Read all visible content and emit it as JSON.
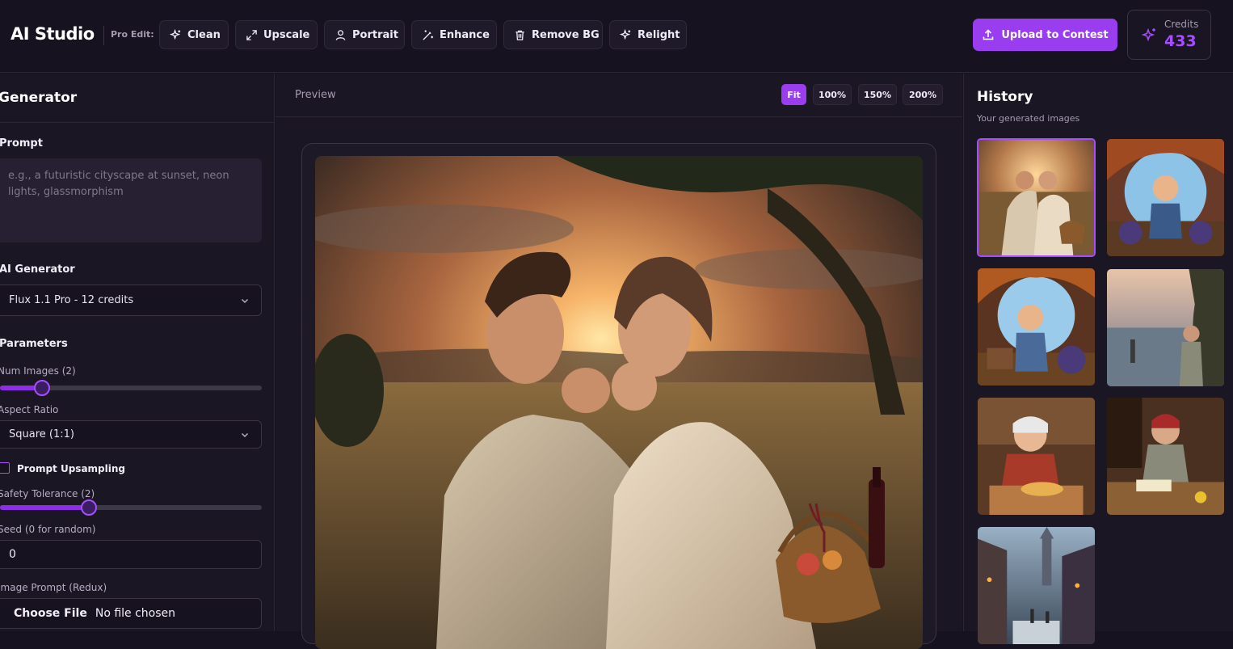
{
  "app": {
    "title": "AI Studio"
  },
  "toolbar": {
    "pro_edit_label": "Pro Edit:",
    "buttons": [
      {
        "label": "Clean",
        "icon": "sparkles-icon"
      },
      {
        "label": "Upscale",
        "icon": "expand-icon"
      },
      {
        "label": "Portrait",
        "icon": "user-icon"
      },
      {
        "label": "Enhance",
        "icon": "magic-wand-icon"
      },
      {
        "label": "Remove BG",
        "icon": "trash-icon"
      },
      {
        "label": "Relight",
        "icon": "sparkles-icon"
      }
    ],
    "upload_label": "Upload to Contest",
    "credits_label": "Credits",
    "credits_value": "433"
  },
  "generator": {
    "title": "Generator",
    "prompt_label": "Prompt",
    "prompt_placeholder": "e.g., a futuristic cityscape at sunset, neon lights, glassmorphism",
    "model_label": "AI Generator",
    "model_value": "Flux 1.1 Pro - 12 credits",
    "params_label": "Parameters",
    "num_images_label": "Num Images (2)",
    "num_images_level": 0.16,
    "aspect_label": "Aspect Ratio",
    "aspect_value": "Square (1:1)",
    "upsampling_label": "Prompt Upsampling",
    "upsampling_checked": false,
    "safety_label": "Safety Tolerance (2)",
    "safety_level": 0.34,
    "seed_label": "Seed (0 for random)",
    "seed_value": "0",
    "redux_label": "Image Prompt (Redux)",
    "file_button": "Choose File",
    "file_status": "No file chosen"
  },
  "preview": {
    "label": "Preview",
    "zoom_options": [
      "Fit",
      "100%",
      "150%",
      "200%"
    ],
    "zoom_active": "Fit"
  },
  "history": {
    "title": "History",
    "subtitle": "Your generated images"
  },
  "colors": {
    "accent": "#9a3cf0",
    "background": "#17121f",
    "panel": "#1b1624"
  }
}
